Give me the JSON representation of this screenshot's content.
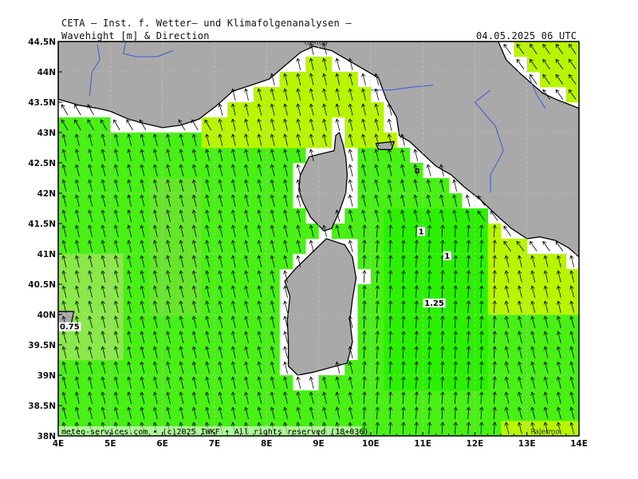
{
  "header": {
    "producer": "CETA — Inst. f. Wetter— und Klimafolgenanalysen —",
    "parameter": "Wavehight [m] & Direction",
    "valid_time": "04.05.2025 06 UTC"
  },
  "footer": {
    "credit": "meteo-services.com • (c)2025 IWKF • All rights reserved (18+036)"
  },
  "map": {
    "lon_range": [
      4,
      14
    ],
    "lat_range": [
      38,
      44.5
    ],
    "x_ticks": [
      "4E",
      "5E",
      "6E",
      "7E",
      "8E",
      "9E",
      "10E",
      "11E",
      "12E",
      "13E",
      "14E"
    ],
    "y_ticks": [
      "38N",
      "38.5N",
      "39N",
      "39.5N",
      "40N",
      "40.5N",
      "41N",
      "41.5N",
      "42N",
      "42.5N",
      "43N",
      "43.5N",
      "44N",
      "44.5N"
    ],
    "place_labels": [
      {
        "text": "Genua",
        "lon": 8.95,
        "lat": 44.45
      },
      {
        "text": "Palermo",
        "lon": 13.35,
        "lat": 38.03
      }
    ],
    "contour_labels": [
      {
        "text": "0.75",
        "lon": 4.22,
        "lat": 39.78
      },
      {
        "text": "1",
        "lon": 10.97,
        "lat": 41.35
      },
      {
        "text": "1",
        "lon": 11.47,
        "lat": 40.95
      },
      {
        "text": "1.25",
        "lon": 11.22,
        "lat": 40.17
      }
    ],
    "colors": {
      "land": "#a9a9a9",
      "coast": "#000000",
      "river": "#3a5ad8",
      "wave_low": "#66e62a",
      "wave_mid": "#48f014",
      "wave_high": "#2bf000",
      "wave_shallow": "#b8f500",
      "grid": "#c8c8c8",
      "arrow": "#000000"
    },
    "wave_direction": "toward north (south-to-north swell)"
  }
}
